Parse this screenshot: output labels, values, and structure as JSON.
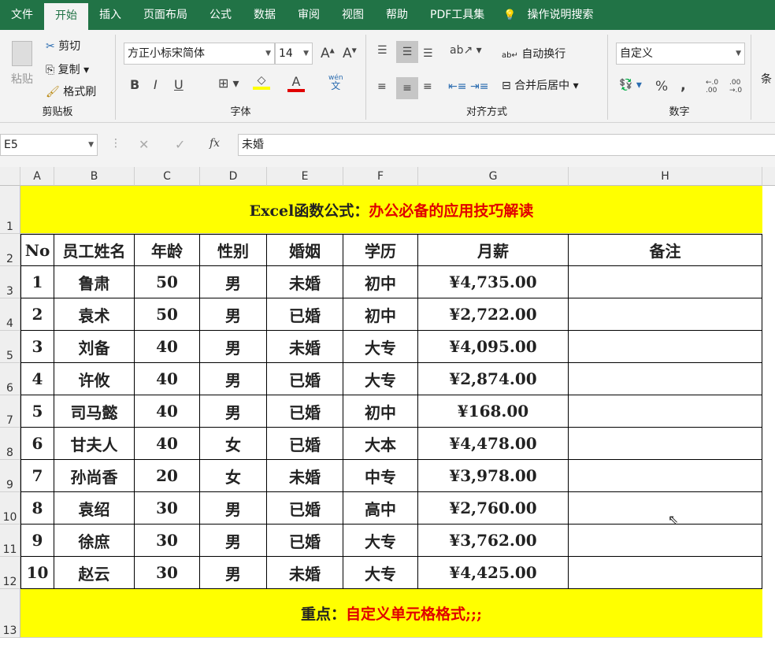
{
  "tabs": [
    "文件",
    "开始",
    "插入",
    "页面布局",
    "公式",
    "数据",
    "审阅",
    "视图",
    "帮助",
    "PDF工具集",
    "操作说明搜索"
  ],
  "clipboard": {
    "paste": "粘贴",
    "cut": "剪切",
    "copy": "复制",
    "format_painter": "格式刷",
    "label": "剪贴板"
  },
  "font": {
    "name": "方正小标宋简体",
    "size": "14",
    "bold": "B",
    "italic": "I",
    "underline": "U",
    "label": "字体",
    "phonetic": "wén\n文"
  },
  "alignment": {
    "wrap": "自动换行",
    "merge": "合并后居中",
    "label": "对齐方式"
  },
  "number": {
    "format": "自定义",
    "percent": "%",
    "comma": ",",
    "label": "数字"
  },
  "styles": {
    "partial": "条"
  },
  "formula_bar": {
    "name_box": "E5",
    "fx": "fx",
    "value": "未婚"
  },
  "columns": [
    "A",
    "B",
    "C",
    "D",
    "E",
    "F",
    "G",
    "H"
  ],
  "rows": [
    "1",
    "2",
    "3",
    "4",
    "5",
    "6",
    "7",
    "8",
    "9",
    "10",
    "11",
    "12",
    "13"
  ],
  "title": {
    "black": "Excel函数公式：",
    "red": "办公必备的应用技巧解读"
  },
  "headers": [
    "No",
    "员工姓名",
    "年龄",
    "性别",
    "婚姻",
    "学历",
    "月薪",
    "备注"
  ],
  "data": [
    [
      "1",
      "鲁肃",
      "50",
      "男",
      "未婚",
      "初中",
      "¥4,735.00",
      ""
    ],
    [
      "2",
      "袁术",
      "50",
      "男",
      "已婚",
      "初中",
      "¥2,722.00",
      ""
    ],
    [
      "3",
      "刘备",
      "40",
      "男",
      "未婚",
      "大专",
      "¥4,095.00",
      ""
    ],
    [
      "4",
      "许攸",
      "40",
      "男",
      "已婚",
      "大专",
      "¥2,874.00",
      ""
    ],
    [
      "5",
      "司马懿",
      "40",
      "男",
      "已婚",
      "初中",
      "¥168.00",
      ""
    ],
    [
      "6",
      "甘夫人",
      "40",
      "女",
      "已婚",
      "大本",
      "¥4,478.00",
      ""
    ],
    [
      "7",
      "孙尚香",
      "20",
      "女",
      "未婚",
      "中专",
      "¥3,978.00",
      ""
    ],
    [
      "8",
      "袁绍",
      "30",
      "男",
      "已婚",
      "高中",
      "¥2,760.00",
      ""
    ],
    [
      "9",
      "徐庶",
      "30",
      "男",
      "已婚",
      "大专",
      "¥3,762.00",
      ""
    ],
    [
      "10",
      "赵云",
      "30",
      "男",
      "未婚",
      "大专",
      "¥4,425.00",
      ""
    ]
  ],
  "footer": {
    "black": "重点：",
    "red": "自定义单元格格式;;;"
  }
}
